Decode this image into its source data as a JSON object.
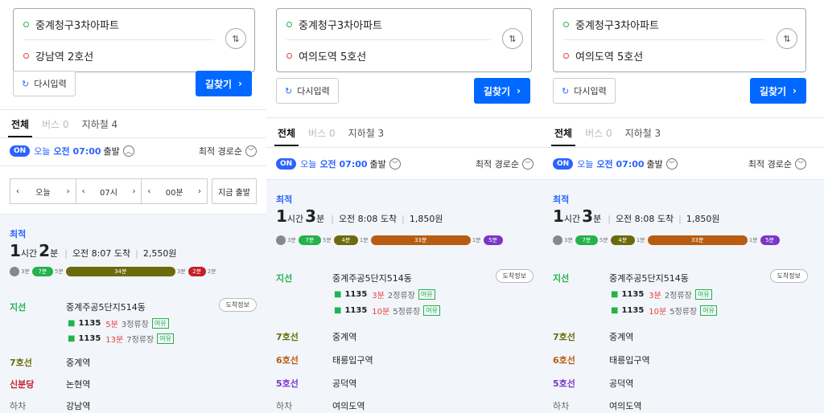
{
  "panels": [
    {
      "from": "중계청구3차아파트",
      "to": "강남역 2호선",
      "reset_label": "다시입력",
      "find_label": "길찾기",
      "tabs": [
        "전체",
        "버스 0",
        "지하철 4"
      ],
      "on_label": "ON",
      "today": "오늘",
      "time": "오전 07:00",
      "depart": "출발",
      "sort": "최적 경로순",
      "stepper": {
        "day": "오늘",
        "hour": "07시",
        "min": "00분",
        "now": "지금 출발"
      },
      "best": "최적",
      "total": {
        "h": "1",
        "hunit": "시간",
        "m": "2",
        "munit": "분",
        "arrive": "오전 8:07 도착",
        "fare": "2,550원"
      },
      "bar": [
        "3분",
        "7분",
        "5분",
        "34분",
        "3분",
        "2분",
        "2분"
      ],
      "rows": [
        {
          "label": "지선",
          "name": "중계주공5단지514동",
          "color": "#24b24b",
          "arrive_info": "도착정보"
        },
        {
          "label": "7호선",
          "name": "중계역",
          "color": "#6b6b0a"
        },
        {
          "label": "신분당",
          "name": "논현역",
          "color": "#c2202b"
        },
        {
          "label": "하차",
          "name": "강남역",
          "color": "#666"
        }
      ],
      "buses": [
        {
          "no": "1135",
          "min": "5분",
          "stop": "3정류장",
          "status": "여유"
        },
        {
          "no": "1135",
          "min": "13분",
          "stop": "7정류장",
          "status": "여유"
        }
      ]
    },
    {
      "from": "중계청구3차아파트",
      "to": "여의도역 5호선",
      "reset_label": "다시입력",
      "find_label": "길찾기",
      "tabs": [
        "전체",
        "버스 0",
        "지하철 3"
      ],
      "on_label": "ON",
      "today": "오늘",
      "time": "오전 07:00",
      "depart": "출발",
      "sort": "최적 경로순",
      "best": "최적",
      "total": {
        "h": "1",
        "hunit": "시간",
        "m": "3",
        "munit": "분",
        "arrive": "오전 8:08 도착",
        "fare": "1,850원"
      },
      "bar": [
        "3분",
        "7분",
        "5분",
        "4분",
        "1분",
        "33분",
        "1분",
        "5분"
      ],
      "rows": [
        {
          "label": "지선",
          "name": "중계주공5단지514동",
          "color": "#24b24b",
          "arrive_info": "도착정보"
        },
        {
          "label": "7호선",
          "name": "중계역",
          "color": "#6b6b0a"
        },
        {
          "label": "6호선",
          "name": "태릉입구역",
          "color": "#b85c12"
        },
        {
          "label": "5호선",
          "name": "공덕역",
          "color": "#7b35c8"
        },
        {
          "label": "하차",
          "name": "여의도역",
          "color": "#666"
        }
      ],
      "buses": [
        {
          "no": "1135",
          "min": "3분",
          "stop": "2정류장",
          "status": "여유"
        },
        {
          "no": "1135",
          "min": "10분",
          "stop": "5정류장",
          "status": "여유"
        }
      ]
    },
    {
      "from": "중계청구3차아파트",
      "to": "여의도역 5호선",
      "reset_label": "다시입력",
      "find_label": "길찾기",
      "tabs": [
        "전체",
        "버스 0",
        "지하철 3"
      ],
      "on_label": "ON",
      "today": "오늘",
      "time": "오전 07:00",
      "depart": "출발",
      "sort": "최적 경로순",
      "best": "최적",
      "total": {
        "h": "1",
        "hunit": "시간",
        "m": "3",
        "munit": "분",
        "arrive": "오전 8:08 도착",
        "fare": "1,850원"
      },
      "bar": [
        "3분",
        "7분",
        "5분",
        "4분",
        "1분",
        "33분",
        "1분",
        "5분"
      ],
      "rows": [
        {
          "label": "지선",
          "name": "중계주공5단지514동",
          "color": "#24b24b",
          "arrive_info": "도착정보"
        },
        {
          "label": "7호선",
          "name": "중계역",
          "color": "#6b6b0a"
        },
        {
          "label": "6호선",
          "name": "태릉입구역",
          "color": "#b85c12"
        },
        {
          "label": "5호선",
          "name": "공덕역",
          "color": "#7b35c8"
        },
        {
          "label": "하차",
          "name": "여의도역",
          "color": "#666"
        }
      ],
      "buses": [
        {
          "no": "1135",
          "min": "3분",
          "stop": "2정류장",
          "status": "여유"
        },
        {
          "no": "1135",
          "min": "10분",
          "stop": "5정류장",
          "status": "여유"
        }
      ]
    }
  ],
  "colors": {
    "green": "#24b24b",
    "line7": "#6b6b0a",
    "line2": "#c2202b",
    "line6": "#b85c12",
    "line5": "#7b35c8",
    "blue": "#0068ff"
  }
}
